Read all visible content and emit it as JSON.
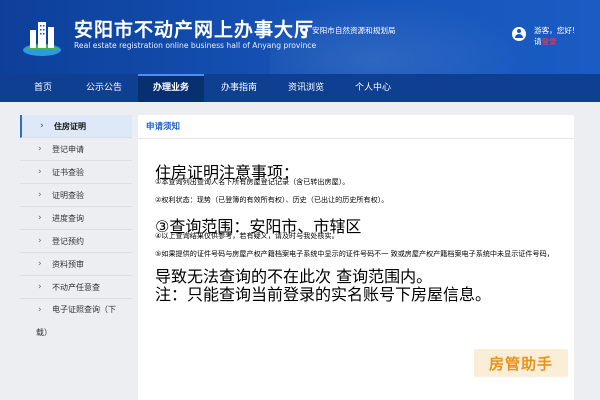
{
  "header": {
    "title": "安阳市不动产网上办事大厅",
    "subtitle": "Real estate registration online business hall of Anyang province",
    "org": "安阳市自然资源和规划局",
    "greeting": "游客，您好!",
    "login_prefix": "请",
    "login_link": "登录"
  },
  "nav": {
    "items": [
      {
        "label": "首页"
      },
      {
        "label": "公示公告"
      },
      {
        "label": "办理业务"
      },
      {
        "label": "办事指南"
      },
      {
        "label": "资讯浏览"
      },
      {
        "label": "个人中心"
      }
    ],
    "active_index": 2
  },
  "sidebar": {
    "items": [
      {
        "label": "住房证明"
      },
      {
        "label": "登记申请"
      },
      {
        "label": "证书查验"
      },
      {
        "label": "证明查验"
      },
      {
        "label": "进度查询"
      },
      {
        "label": "登记预约"
      },
      {
        "label": "资料预审"
      },
      {
        "label": "不动产任意查"
      },
      {
        "label": "电子证照查询（下"
      }
    ],
    "last_item_wrap": "载）",
    "active_index": 0
  },
  "panel": {
    "title": "申请须知",
    "lines": [
      "住房证明注意事项：",
      "①本查询列出查询人名下所有房屋登记记录（含已转出房屋）。",
      "②权利状态：现势（已登簿的有效所有权）、历史（已出让的历史所有权）。",
      "③查询范围：安阳市、市辖区",
      "④以上查询结果仅供参考，若有疑义，请及时与我处核实。",
      "⑤如果提供的证件号码与房屋产权产籍档案电子系统中显示的证件号码不一 致或房屋产权产籍档案电子系统中未显示证件号码，",
      "导致无法查询的不在此次 查询范围内。",
      "注：只能查询当前登录的实名账号下房屋信息。"
    ]
  },
  "watermark": {
    "text": "房管助手"
  },
  "colors": {
    "header_blue": "#1654b8",
    "nav_blue": "#0e3f91",
    "nav_active": "#082f70",
    "accent": "#1f5fc4",
    "login_red": "#ff3b3b"
  }
}
